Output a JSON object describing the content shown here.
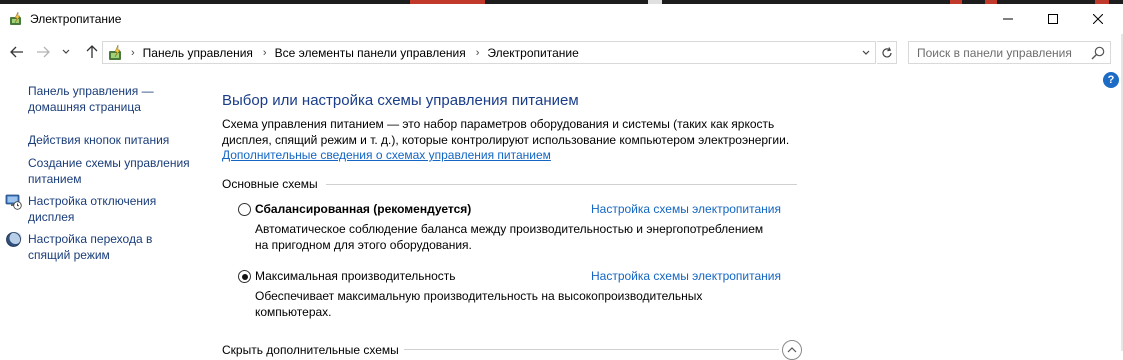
{
  "window": {
    "title": "Электропитание"
  },
  "colors": {
    "link": "#1366c4",
    "heading": "#1a3d8a",
    "sidebar_link": "#1a3d7a",
    "help_badge": "#1c6bc4"
  },
  "address": {
    "crumbs": [
      "Панель управления",
      "Все элементы панели управления",
      "Электропитание"
    ]
  },
  "search": {
    "placeholder": "Поиск в панели управления"
  },
  "sidebar": {
    "items": [
      {
        "label": "Панель управления —",
        "label2": "домашняя страница",
        "icon": ""
      },
      {
        "label": "Действия кнопок питания",
        "label2": "",
        "icon": ""
      },
      {
        "label": "Создание схемы управления",
        "label2": "питанием",
        "icon": ""
      },
      {
        "label": "Настройка отключения",
        "label2": "дисплея",
        "icon": "display-clock-icon"
      },
      {
        "label": "Настройка перехода в",
        "label2": "спящий режим",
        "icon": "moon-icon"
      }
    ]
  },
  "main": {
    "heading": "Выбор или настройка схемы управления питанием",
    "description_line1": "Схема управления питанием — это набор параметров оборудования и системы (таких как яркость",
    "description_line2": "дисплея, спящий режим и т. д.), которые контролируют использование компьютером электроэнергии.",
    "more_link": "Дополнительные сведения о схемах управления питанием",
    "group_label": "Основные схемы",
    "plans": [
      {
        "name": "Сбалансированная (рекомендуется)",
        "selected": false,
        "link": "Настройка схемы электропитания",
        "desc_line1": "Автоматическое соблюдение баланса между производительностью и энергопотреблением",
        "desc_line2": "на пригодном для этого оборудования."
      },
      {
        "name": "Максимальная производительность",
        "selected": true,
        "link": "Настройка схемы электропитания",
        "desc_line1": "Обеспечивает максимальную производительность на высокопроизводительных",
        "desc_line2": "компьютерах."
      }
    ],
    "hide_label": "Скрыть дополнительные схемы"
  },
  "icons": {
    "back": "arrow-left-icon",
    "forward": "arrow-right-icon",
    "recent": "chevron-down-icon",
    "up": "arrow-up-icon",
    "refresh": "refresh-icon",
    "search": "search-icon",
    "help": "help-icon",
    "minimize": "minimize-icon",
    "maximize": "maximize-icon",
    "close": "close-icon"
  },
  "help_glyph": "?"
}
